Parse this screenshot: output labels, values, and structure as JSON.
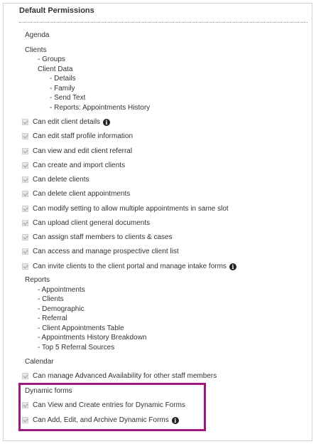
{
  "title": "Default Permissions",
  "sections": {
    "agenda": "Agenda",
    "clients": "Clients",
    "groups": "- Groups",
    "client_data": "Client Data",
    "details": "- Details",
    "family": "- Family",
    "send_text": "- Send Text",
    "reports_appt_history": "- Reports: Appointments History",
    "reports": "Reports",
    "appointments": "- Appointments",
    "clients_item": "- Clients",
    "demographic": "- Demographic",
    "referral": "- Referral",
    "client_appt_table": "- Client Appointments Table",
    "appt_history_breakdown": "- Appointments History Breakdown",
    "top5_referral": "- Top 5 Referral Sources",
    "calendar": "Calendar",
    "dynamic_forms": "Dynamic forms"
  },
  "permissions": [
    "Can edit client details",
    "Can edit staff profile information",
    "Can view and edit client referral",
    "Can create and import clients",
    "Can delete clients",
    "Can delete client appointments",
    "Can modify setting to allow multiple appointments in same slot",
    "Can upload client general documents",
    "Can assign staff members to clients & cases",
    "Can access and manage prospective client list",
    "Can invite clients to the client portal and manage intake forms",
    "Can manage Advanced Availability for other staff members",
    "Can View and Create entries for Dynamic Forms",
    "Can Add, Edit, and Archive Dynamic Forms"
  ],
  "info_glyph": "i",
  "colors": {
    "highlight": "#9c1b7a",
    "checkbox": "#e6e6e6"
  }
}
